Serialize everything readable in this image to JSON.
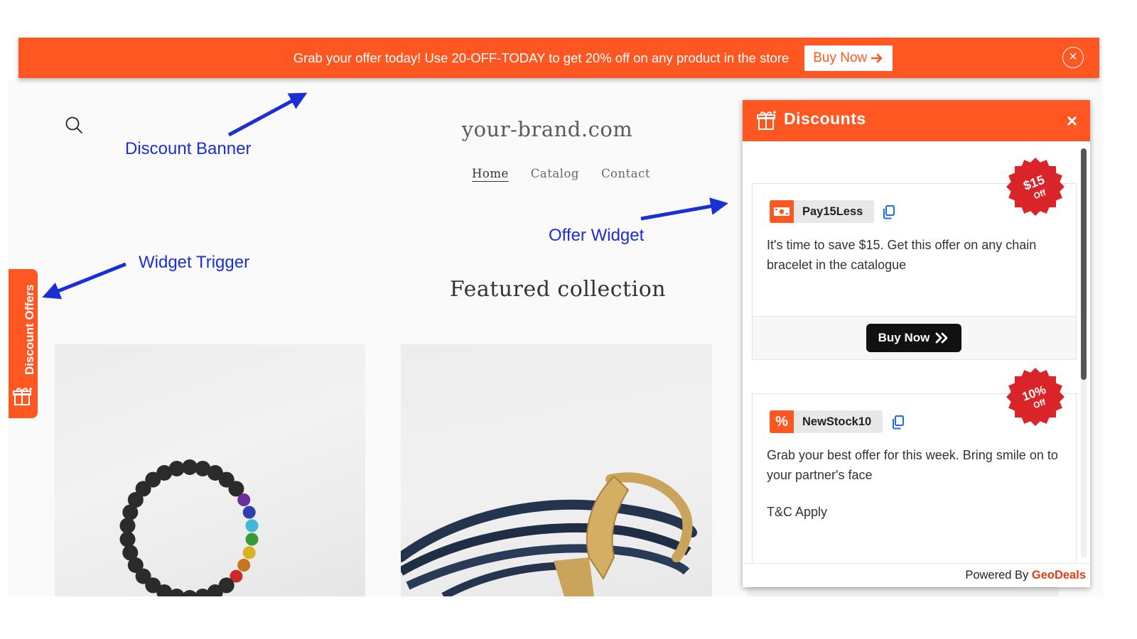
{
  "banner": {
    "message": "Grab your offer today! Use 20-OFF-TODAY to get 20% off on any product in the store",
    "button_label": "Buy Now",
    "color": "#fe5722"
  },
  "store": {
    "brand": "your-brand.com",
    "nav": [
      {
        "label": "Home",
        "active": true
      },
      {
        "label": "Catalog"
      },
      {
        "label": "Contact"
      }
    ],
    "section_title": "Featured collection"
  },
  "annotations": {
    "banner": "Discount Banner",
    "widget": "Offer Widget",
    "trigger": "Widget Trigger"
  },
  "trigger": {
    "label": "Discount Offers"
  },
  "widget": {
    "title": "Discounts",
    "offers": [
      {
        "code": "Pay15Less",
        "code_icon": "cash-icon",
        "description": "It's time to save $15.  Get this offer on any chain bracelet in the catalogue",
        "button_label": "Buy Now",
        "seal_value": "$15",
        "seal_suffix": "Off"
      },
      {
        "code": "NewStock10",
        "code_icon": "percent-icon",
        "description": "Grab your best offer for this week. Bring smile on to your partner's face",
        "terms": "T&C Apply",
        "seal_value": "10%",
        "seal_suffix": "Off"
      }
    ],
    "footer_prefix": "Powered By ",
    "footer_brand": "GeoDeals"
  },
  "colors": {
    "accent": "#fe5722",
    "annotation": "#1a2fd6",
    "seal": "#d9252a"
  }
}
